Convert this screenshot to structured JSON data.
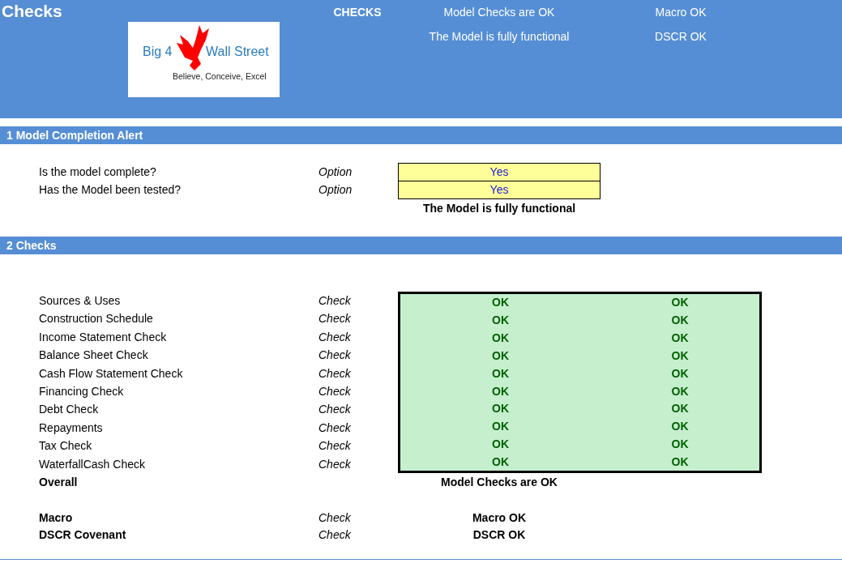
{
  "header": {
    "title": "Checks",
    "label": "CHECKS",
    "messages": [
      "Model Checks are OK",
      "The Model is fully functional"
    ],
    "flags": [
      "Macro OK",
      "DSCR OK"
    ]
  },
  "logo": {
    "brand_left": "Big 4",
    "brand_right": "Wall Street",
    "tagline": "Believe, Conceive, Excel"
  },
  "completion": {
    "title": "1  Model Completion Alert",
    "rows": [
      {
        "label": "Is the model complete?",
        "type": "Option",
        "value": "Yes"
      },
      {
        "label": "Has the Model been tested?",
        "type": "Option",
        "value": "Yes"
      }
    ],
    "result": "The Model is fully functional"
  },
  "checks": {
    "title": "2  Checks",
    "rows": [
      {
        "label": "Sources & Uses",
        "type": "Check",
        "values": [
          "OK",
          "OK"
        ]
      },
      {
        "label": "Construction Schedule",
        "type": "Check",
        "values": [
          "OK",
          "OK"
        ]
      },
      {
        "label": "Income Statement Check",
        "type": "Check",
        "values": [
          "OK",
          "OK"
        ]
      },
      {
        "label": "Balance Sheet Check",
        "type": "Check",
        "values": [
          "OK",
          "OK"
        ]
      },
      {
        "label": "Cash Flow Statement Check",
        "type": "Check",
        "values": [
          "OK",
          "OK"
        ]
      },
      {
        "label": "Financing Check",
        "type": "Check",
        "values": [
          "OK",
          "OK"
        ]
      },
      {
        "label": "Debt Check",
        "type": "Check",
        "values": [
          "OK",
          "OK"
        ]
      },
      {
        "label": "Repayments",
        "type": "Check",
        "values": [
          "OK",
          "OK"
        ]
      },
      {
        "label": "Tax Check",
        "type": "Check",
        "values": [
          "OK",
          "OK"
        ]
      },
      {
        "label": "WaterfallCash Check",
        "type": "Check",
        "values": [
          "OK",
          "OK"
        ]
      }
    ],
    "overall": {
      "label": "Overall",
      "value": "Model Checks are OK"
    },
    "extra": [
      {
        "label": "Macro",
        "type": "Check",
        "value": "Macro OK"
      },
      {
        "label": "DSCR Covenant",
        "type": "Check",
        "value": "DSCR OK"
      }
    ]
  }
}
